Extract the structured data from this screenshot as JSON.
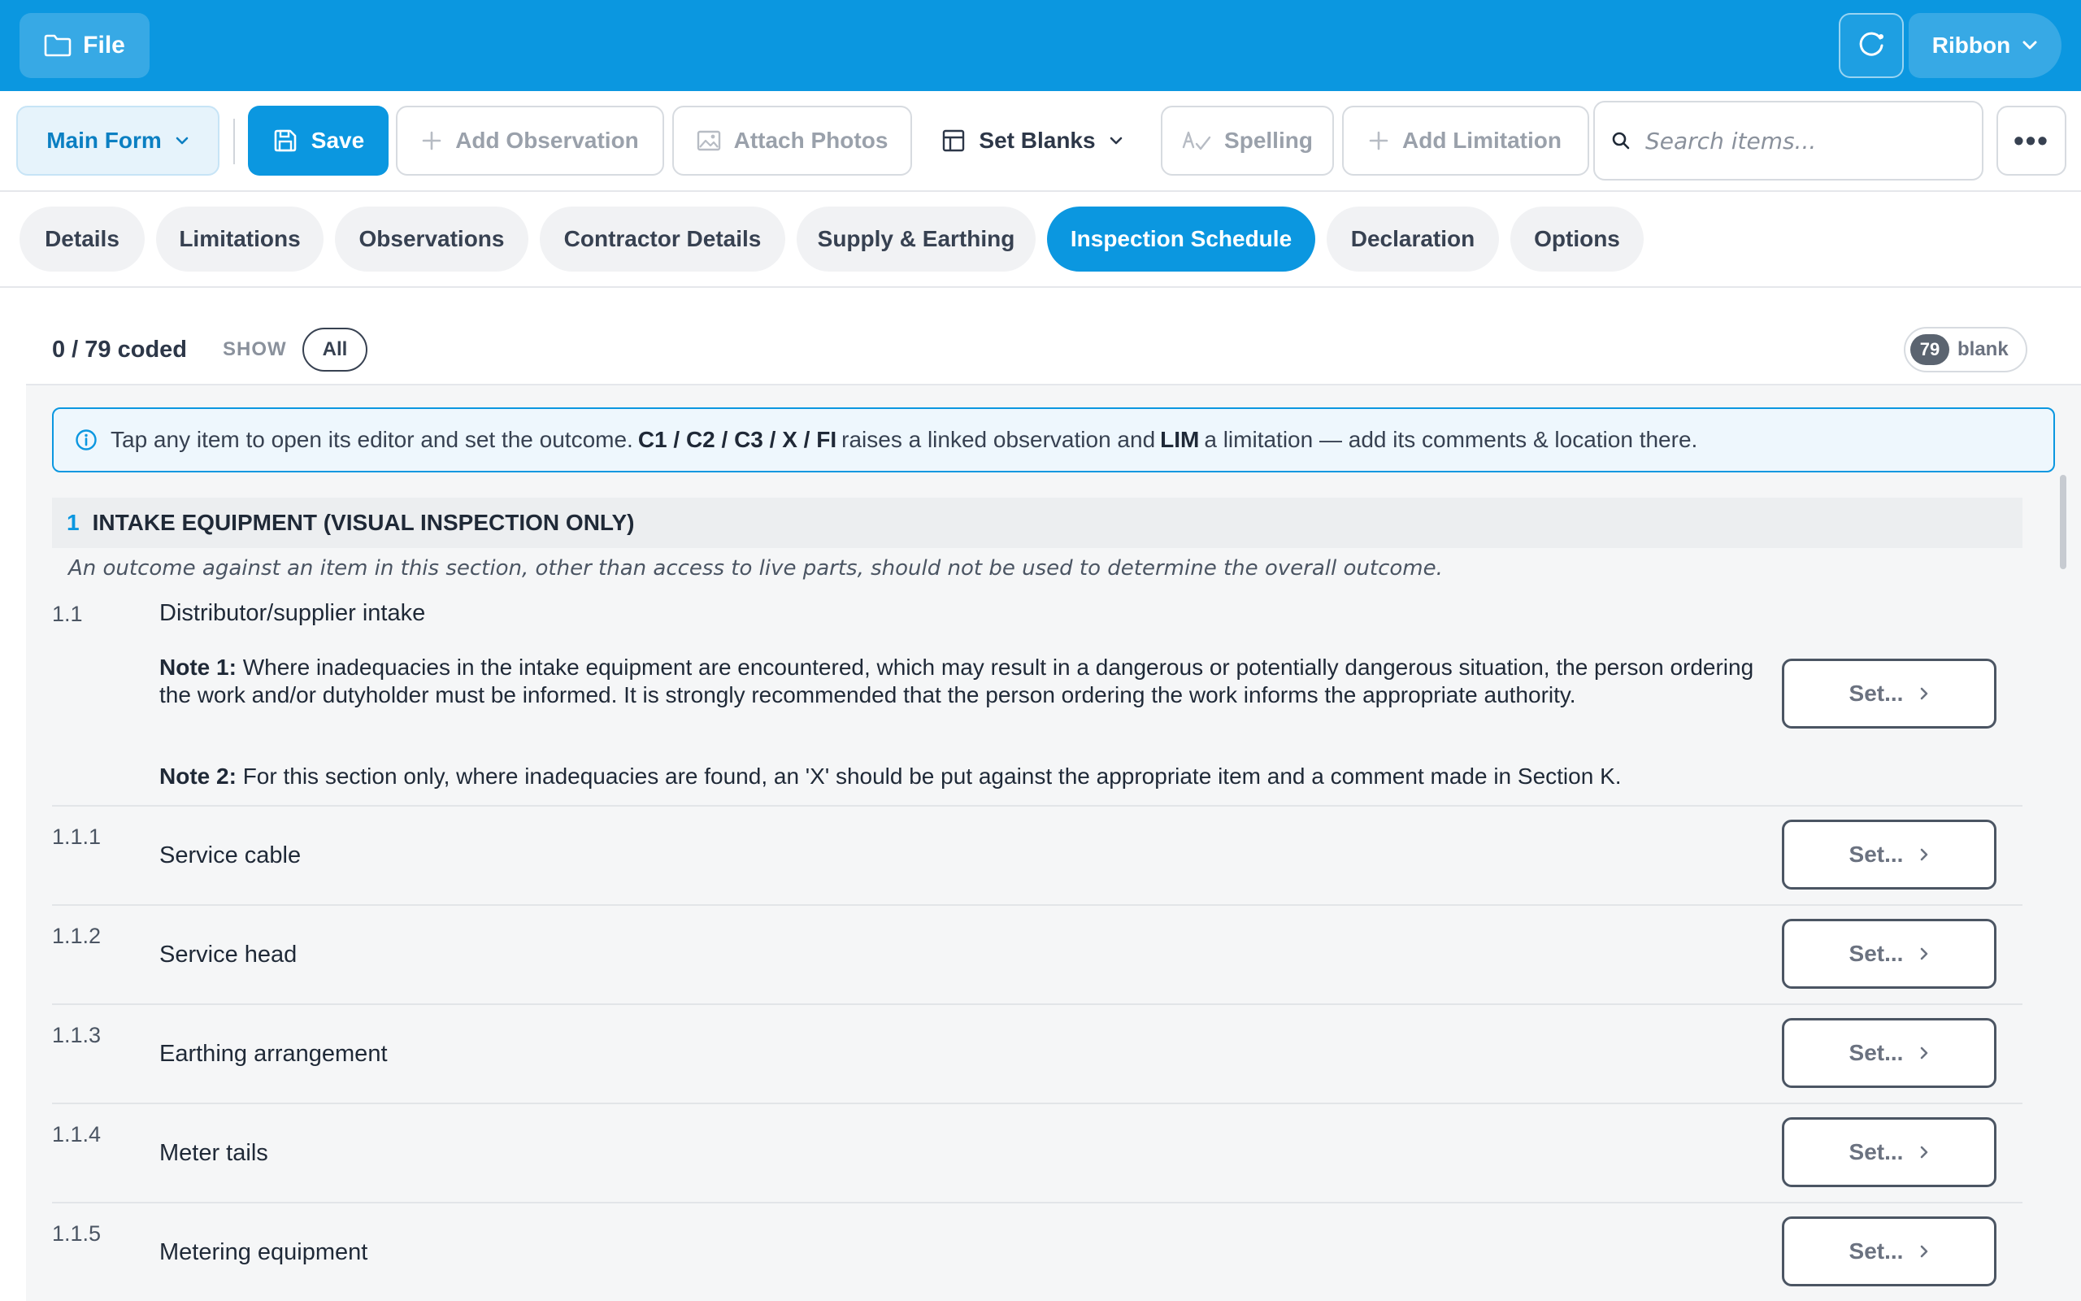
{
  "topbar": {
    "file_label": "File",
    "ribbon_label": "Ribbon"
  },
  "toolbar": {
    "main_form_label": "Main Form",
    "save_label": "Save",
    "add_observation_label": "Add Observation",
    "attach_photos_label": "Attach Photos",
    "set_blanks_label": "Set Blanks",
    "spelling_label": "Spelling",
    "add_limitation_label": "Add Limitation",
    "search_placeholder": "Search items...",
    "more_label": "•••"
  },
  "tabs": [
    {
      "label": "Details"
    },
    {
      "label": "Limitations"
    },
    {
      "label": "Observations"
    },
    {
      "label": "Contractor Details"
    },
    {
      "label": "Supply & Earthing"
    },
    {
      "label": "Inspection Schedule",
      "active": true
    },
    {
      "label": "Declaration"
    },
    {
      "label": "Options"
    }
  ],
  "summary": {
    "coded_text": "0 / 79 coded",
    "show_label": "SHOW",
    "filter_value": "All",
    "blank_count": "79",
    "blank_label": "blank"
  },
  "info": {
    "text_1": "Tap any item to open its editor and set the outcome.",
    "codes": "C1 / C2 / C3 / X / FI",
    "text_2": "raises a linked observation and",
    "lim": "LIM",
    "text_3": "a limitation — add its comments & location there."
  },
  "section": {
    "number": "1",
    "title": "INTAKE EQUIPMENT (VISUAL INSPECTION ONLY)",
    "note": "An outcome against an item in this section, other than access to live parts, should not be used to determine the overall outcome."
  },
  "items": [
    {
      "number": "1.1",
      "title": "Distributor/supplier intake",
      "note1_label": "Note 1:",
      "note1_text": "Where inadequacies in the intake equipment are encountered, which may result in a dangerous or potentially dangerous situation, the person ordering the work and/or dutyholder must be informed. It is strongly recommended that the person ordering the work informs the appropriate authority.",
      "note2_label": "Note 2:",
      "note2_text": "For this section only, where inadequacies are found, an 'X' should be put against the appropriate item and a comment made in Section K.",
      "set_label": "Set..."
    },
    {
      "number": "1.1.1",
      "title": "Service cable",
      "set_label": "Set..."
    },
    {
      "number": "1.1.2",
      "title": "Service head",
      "set_label": "Set..."
    },
    {
      "number": "1.1.3",
      "title": "Earthing arrangement",
      "set_label": "Set..."
    },
    {
      "number": "1.1.4",
      "title": "Meter tails",
      "set_label": "Set..."
    },
    {
      "number": "1.1.5",
      "title": "Metering equipment",
      "set_label": "Set..."
    }
  ],
  "icons": {
    "file": "folder-icon",
    "refresh": "refresh-icon",
    "ribbon": "chevron-down-icon",
    "save": "save-icon",
    "add": "plus-icon",
    "photos": "image-icon",
    "blanks": "table-icon",
    "spelling": "spellcheck-icon",
    "search": "search-icon",
    "info": "info-icon",
    "set": "chevron-right-icon"
  },
  "colors": {
    "accent": "#0b97e0",
    "active_tab_text": "#ffffff",
    "info_bg": "#eef7fd"
  }
}
